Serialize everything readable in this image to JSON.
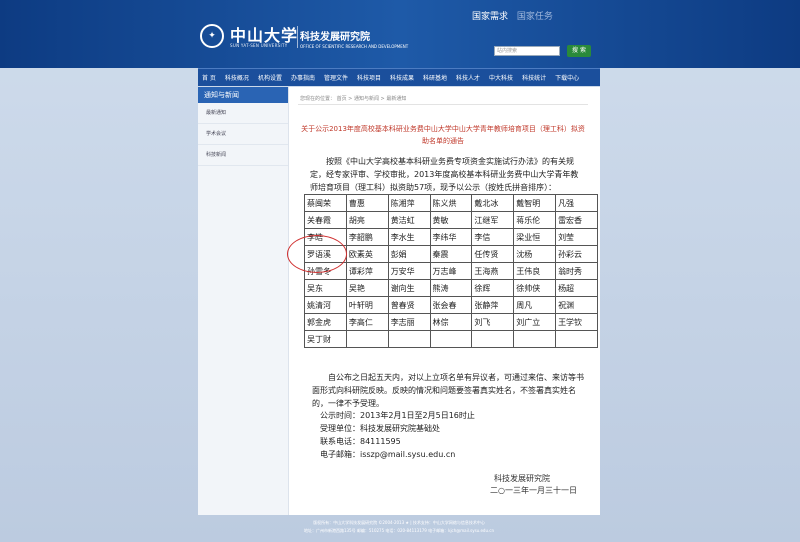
{
  "header": {
    "logo_cn": "中山大学",
    "logo_en": "SUN YAT-SEN UNIVERSITY",
    "office_cn": "科技发展研究院",
    "office_en": "OFFICE OF SCIENTIFIC RESEARCH AND DEVELOPMENT",
    "top_link_1": "国家需求",
    "top_link_2": "国家任务",
    "search_placeholder": "站内搜索",
    "search_button": "搜 索"
  },
  "nav": {
    "items": [
      "首 页",
      "科技概况",
      "机构设置",
      "办事指南",
      "管理文件",
      "科技项目",
      "科技成果",
      "科研基地",
      "科技人才",
      "中大科技",
      "科技统计",
      "下载中心"
    ]
  },
  "sidebar": {
    "title": "通知与新闻",
    "items": [
      "最新通知",
      "学术会议",
      "科技新闻"
    ]
  },
  "breadcrumb": "您现在的位置： 首页 > 通知与新闻 > 最新通知",
  "article": {
    "title": "关于公示2013年度高校基本科研业务费中山大学中山大学青年教师培育项目（理工科）拟资助名单的通告",
    "intro": "按照《中山大学高校基本科研业务费专项资金实施试行办法》的有关规定，经专家评审、学校审批，2013年度高校基本科研业务费中山大学青年教师培育项目（理工科）拟资助57项，现予以公示（按姓氏拼音排序）：",
    "names": [
      [
        "蔡闽荣",
        "曹惠",
        "陈湘萍",
        "陈义烘",
        "戴北冰",
        "戴智明",
        "凡强"
      ],
      [
        "关春霞",
        "胡亮",
        "黄洁虹",
        "黄敏",
        "江继军",
        "蒋乐伦",
        "雷宏香"
      ],
      [
        "李皓",
        "李韶鹏",
        "李水生",
        "李纬华",
        "李信",
        "梁业恒",
        "刘莹"
      ],
      [
        "罗语溪",
        "欧素英",
        "彭娟",
        "秦震",
        "任传贤",
        "沈杨",
        "孙彩云"
      ],
      [
        "孙雪冬",
        "谭彩萍",
        "万安华",
        "万志峰",
        "王海燕",
        "王伟良",
        "翁时秀"
      ],
      [
        "吴东",
        "吴艳",
        "谢向生",
        "熊涛",
        "徐辉",
        "徐帅侠",
        "杨超"
      ],
      [
        "姚清河",
        "叶轩明",
        "曾春贤",
        "张会春",
        "张静萍",
        "周凡",
        "祝渊"
      ],
      [
        "郭金虎",
        "李高仁",
        "李志丽",
        "林倧",
        "刘飞",
        "刘广立",
        "王学钦"
      ],
      [
        "吴丁财",
        "",
        "",
        "",
        "",
        "",
        ""
      ]
    ],
    "notice": "自公布之日起五天内，对以上立项名单有异议者，可通过来信、来访等书面形式向科研院反映。反映的情况和问题要签署真实姓名，不签署真实姓名的，一律不予受理。",
    "info": [
      "公示时间：2013年2月1日至2月5日16时止",
      "受理单位：科技发展研究院基础处",
      "联系电话：84111595",
      "电子邮箱：isszp@mail.sysu.edu.cn"
    ],
    "signature": "科技发展研究院",
    "date": "二○一三年一月三十一日"
  },
  "footer": {
    "line1": "版权所有：中山大学科技发展研究院 ©2004-2013 ★ | 技术支持：中山大学网络与信息技术中心",
    "line2": "地址：广州市新港西路135号 邮编：510275 电话：020-84113179 电子邮箱：kjch@mail.sysu.edu.cn"
  }
}
